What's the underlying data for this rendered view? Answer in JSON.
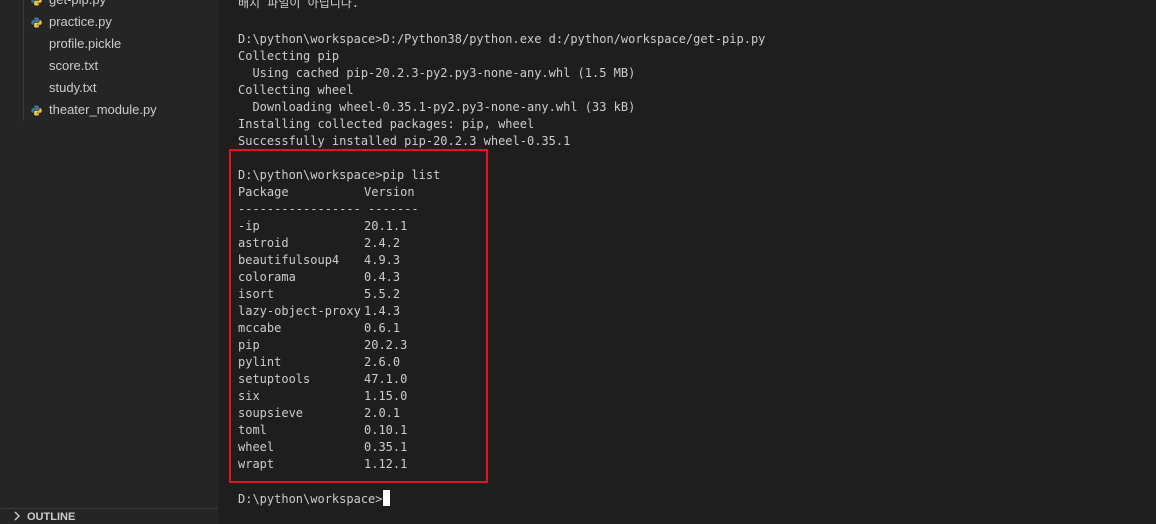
{
  "explorer": {
    "files": [
      {
        "name": "get-pip.py",
        "icon": "python-file-icon"
      },
      {
        "name": "practice.py",
        "icon": "python-file-icon"
      },
      {
        "name": "profile.pickle",
        "icon": "none"
      },
      {
        "name": "score.txt",
        "icon": "none"
      },
      {
        "name": "study.txt",
        "icon": "none"
      },
      {
        "name": "theater_module.py",
        "icon": "python-file-icon"
      }
    ],
    "outline_label": "OUTLINE"
  },
  "terminal": {
    "notice": "배치 파일이 아닙니다.",
    "install_output": [
      "D:\\python\\workspace>D:/Python38/python.exe d:/python/workspace/get-pip.py",
      "Collecting pip",
      "  Using cached pip-20.2.3-py2.py3-none-any.whl (1.5 MB)",
      "Collecting wheel",
      "  Downloading wheel-0.35.1-py2.py3-none-any.whl (33 kB)",
      "Installing collected packages: pip, wheel",
      "Successfully installed pip-20.2.3 wheel-0.35.1"
    ],
    "pip_list_command": "D:\\python\\workspace>pip list",
    "table_header": {
      "package": "Package",
      "version": "Version"
    },
    "separator": "----------------- -------",
    "packages": [
      {
        "name": "-ip",
        "version": "20.1.1"
      },
      {
        "name": "astroid",
        "version": "2.4.2"
      },
      {
        "name": "beautifulsoup4",
        "version": "4.9.3"
      },
      {
        "name": "colorama",
        "version": "0.4.3"
      },
      {
        "name": "isort",
        "version": "5.5.2"
      },
      {
        "name": "lazy-object-proxy",
        "version": "1.4.3"
      },
      {
        "name": "mccabe",
        "version": "0.6.1"
      },
      {
        "name": "pip",
        "version": "20.2.3"
      },
      {
        "name": "pylint",
        "version": "2.6.0"
      },
      {
        "name": "setuptools",
        "version": "47.1.0"
      },
      {
        "name": "six",
        "version": "1.15.0"
      },
      {
        "name": "soupsieve",
        "version": "2.0.1"
      },
      {
        "name": "toml",
        "version": "0.10.1"
      },
      {
        "name": "wheel",
        "version": "0.35.1"
      },
      {
        "name": "wrapt",
        "version": "1.12.1"
      }
    ],
    "prompt": "D:\\python\\workspace>"
  },
  "colors": {
    "highlight_border": "#e81123",
    "python_icon_blue": "#3c78aa",
    "python_icon_yellow": "#f2c83a"
  }
}
